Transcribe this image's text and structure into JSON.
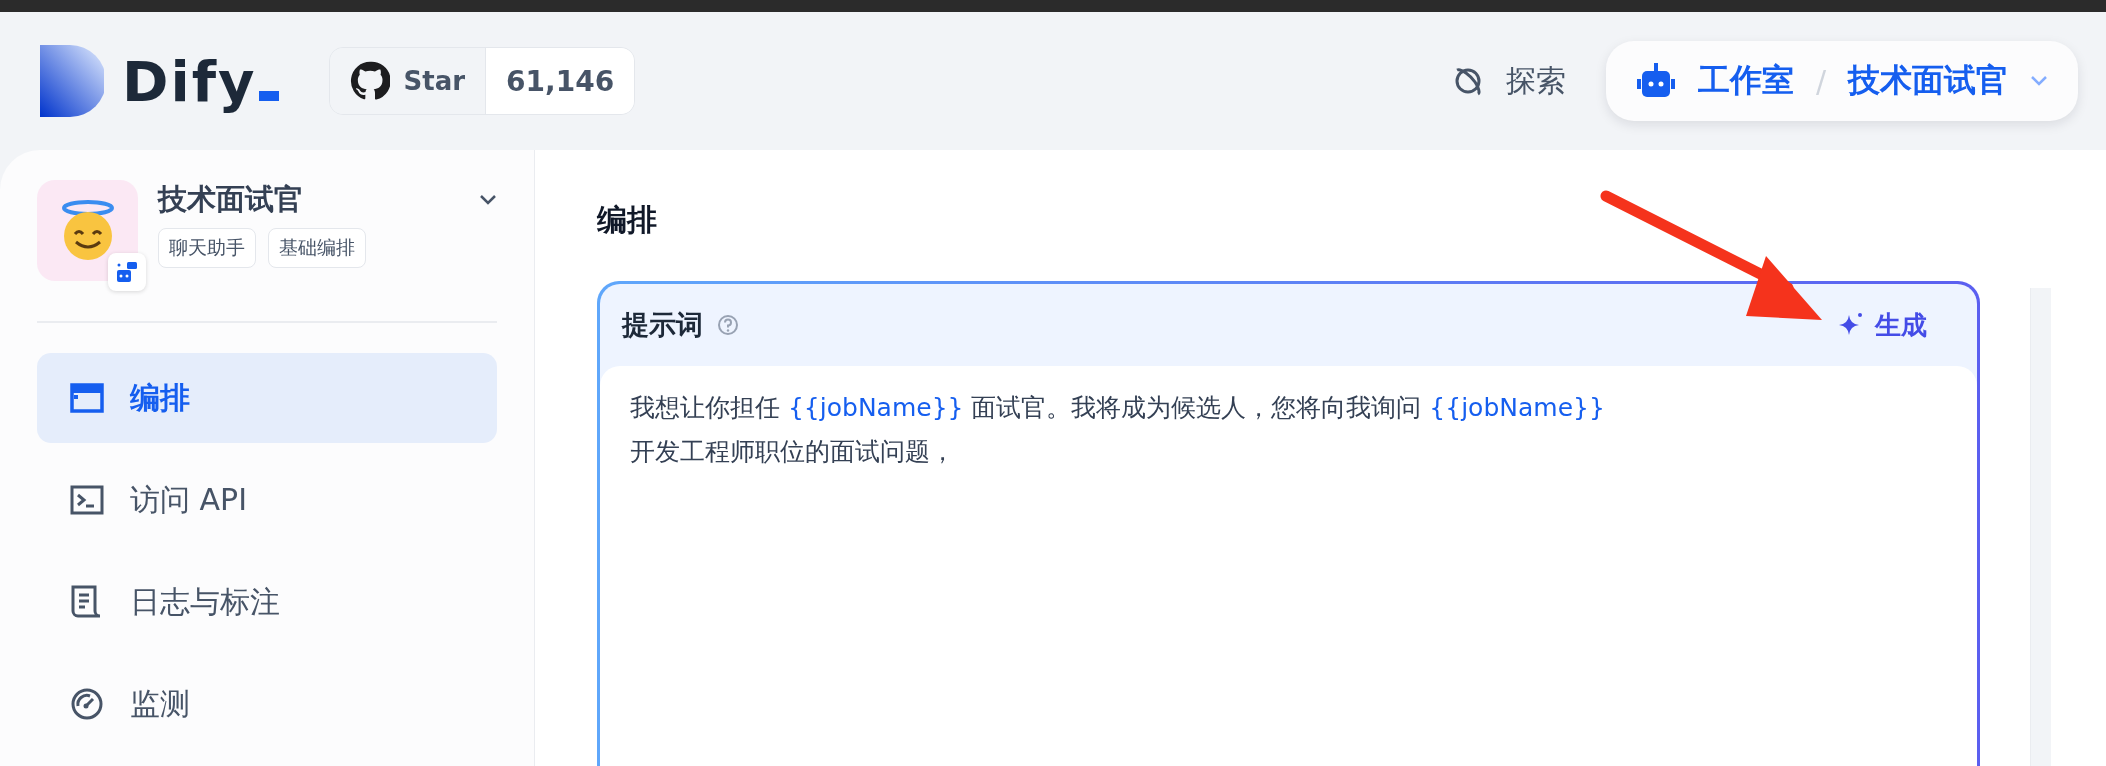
{
  "header": {
    "logo": "Dify",
    "github": {
      "label": "Star",
      "count": "61,146"
    },
    "explore": "探索",
    "breadcrumb": {
      "workspace": "工作室",
      "separator": "/",
      "app": "技术面试官"
    }
  },
  "sidebar": {
    "app": {
      "name": "技术面试官",
      "tags": [
        "聊天助手",
        "基础编排"
      ]
    },
    "items": [
      {
        "label": "编排",
        "selected": true
      },
      {
        "label": "访问 API",
        "selected": false
      },
      {
        "label": "日志与标注",
        "selected": false
      },
      {
        "label": "监测",
        "selected": false
      }
    ]
  },
  "main": {
    "title": "编排",
    "prompt": {
      "title": "提示词",
      "generate": "生成",
      "lines": [
        [
          {
            "kind": "text",
            "text": "我想让你担任 "
          },
          {
            "kind": "variable",
            "text": "{{jobName}}"
          },
          {
            "kind": "text",
            "text": " 面试官。我将成为候选人，您将向我询问 "
          },
          {
            "kind": "variable",
            "text": "{{jobName}}"
          }
        ],
        [
          {
            "kind": "text",
            "text": "开发工程师职位的面试问题，"
          }
        ]
      ]
    }
  }
}
